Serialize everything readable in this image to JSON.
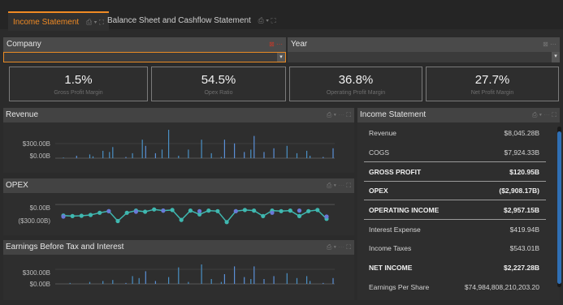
{
  "tabs": [
    {
      "label": "Income Statement",
      "active": true
    },
    {
      "label": "Balance Sheet and Cashflow Statement",
      "active": false
    }
  ],
  "filters": {
    "company": {
      "label": "Company",
      "value": ""
    },
    "year": {
      "label": "Year",
      "value": ""
    }
  },
  "kpis": [
    {
      "value": "1.5%",
      "label": "Gross Profit Margin"
    },
    {
      "value": "54.5%",
      "label": "Opex Ratio"
    },
    {
      "value": "36.8%",
      "label": "Operating Profit Margin"
    },
    {
      "value": "27.7%",
      "label": "Net Profit Margin"
    }
  ],
  "panels": {
    "revenue": {
      "title": "Revenue"
    },
    "opex": {
      "title": "OPEX"
    },
    "ebit": {
      "title": "Earnings Before Tax and Interest"
    },
    "income_statement": {
      "title": "Income Statement"
    }
  },
  "chart_data": [
    {
      "type": "bar",
      "title": "Revenue",
      "tick_labels": [
        "$300.00B",
        "$0.00B"
      ],
      "ylim": [
        0,
        500
      ],
      "colors": [
        "#4a8fc4",
        "#5a8fd6"
      ],
      "values": [
        0,
        0,
        1,
        0,
        0,
        0,
        4,
        0,
        0,
        0,
        6,
        3,
        0,
        0,
        12,
        0,
        10,
        18,
        0,
        0,
        0,
        2,
        0,
        8,
        0,
        0,
        30,
        20,
        0,
        0,
        8,
        0,
        14,
        0,
        46,
        0,
        0,
        4,
        0,
        0,
        14,
        0,
        0,
        0,
        30,
        0,
        0,
        8,
        0,
        0,
        2,
        30,
        0,
        0,
        24,
        0,
        0,
        10,
        0,
        14,
        36,
        0,
        0,
        10,
        0,
        0,
        16,
        0,
        0,
        0,
        20,
        0,
        0,
        8,
        0,
        0,
        12,
        4,
        0,
        0,
        0,
        2,
        0,
        0,
        16
      ]
    },
    {
      "type": "line",
      "title": "OPEX",
      "tick_labels": [
        "$0.00B",
        "($300.00B)"
      ],
      "ylim": [
        -500,
        150
      ],
      "colors": [
        "#3fb8b0",
        "#6a78d8"
      ],
      "series_main": [
        -200,
        -210,
        -205,
        -190,
        -150,
        -120,
        -300,
        -150,
        -110,
        -130,
        -90,
        -110,
        -100,
        -280,
        -110,
        -180,
        -110,
        -120,
        -320,
        -120,
        -100,
        -110,
        -210,
        -110,
        -120,
        -110,
        -210,
        -120,
        -100,
        -260
      ],
      "series_marks": [
        -220,
        null,
        null,
        null,
        null,
        -120,
        null,
        null,
        -130,
        null,
        null,
        -110,
        null,
        null,
        null,
        -120,
        null,
        null,
        null,
        -120,
        null,
        null,
        null,
        -150,
        null,
        null,
        -110,
        null,
        null,
        -220
      ]
    },
    {
      "type": "bar",
      "title": "Earnings Before Tax and Interest",
      "tick_labels": [
        "$300.00B",
        "$0.00B"
      ],
      "ylim": [
        0,
        500
      ],
      "colors": [
        "#4a8fc4",
        "#5a8fd6"
      ],
      "values": [
        0,
        0,
        0,
        0,
        2,
        0,
        0,
        0,
        0,
        0,
        4,
        0,
        0,
        0,
        6,
        0,
        0,
        8,
        0,
        0,
        0,
        2,
        0,
        16,
        0,
        12,
        0,
        26,
        0,
        0,
        6,
        0,
        0,
        0,
        14,
        0,
        0,
        34,
        0,
        0,
        4,
        0,
        0,
        0,
        40,
        0,
        0,
        10,
        0,
        0,
        4,
        20,
        0,
        0,
        36,
        0,
        0,
        14,
        0,
        10,
        36,
        0,
        0,
        10,
        0,
        0,
        16,
        0,
        0,
        0,
        22,
        0,
        0,
        12,
        0,
        0,
        16,
        6,
        0,
        0,
        0,
        2,
        0,
        0,
        12
      ]
    }
  ],
  "income_statement": [
    {
      "label": "Revenue",
      "value": "$8,045.28B",
      "bold": false
    },
    {
      "label": "COGS",
      "value": "$7,924.33B",
      "bold": false
    },
    {
      "label": "GROSS PROFIT",
      "value": "$120.95B",
      "bold": true
    },
    {
      "label": "OPEX",
      "value": "($2,908.17B)",
      "bold": true
    },
    {
      "label": "OPERATING INCOME",
      "value": "$2,957.15B",
      "bold": true
    },
    {
      "label": "Interest Expense",
      "value": "$419.94B",
      "bold": false
    },
    {
      "label": "Income Taxes",
      "value": "$543.01B",
      "bold": false
    },
    {
      "label": "NET INCOME",
      "value": "$2,227.28B",
      "bold": true
    },
    {
      "label": "Earnings Per Share",
      "value": "$74,984,808,210,203.20",
      "bold": false
    }
  ],
  "icons": [
    "export-icon",
    "chevron-down-icon",
    "maximize-icon",
    "filter-icon",
    "clear-filter-icon"
  ],
  "accent_color": "#f08a24"
}
